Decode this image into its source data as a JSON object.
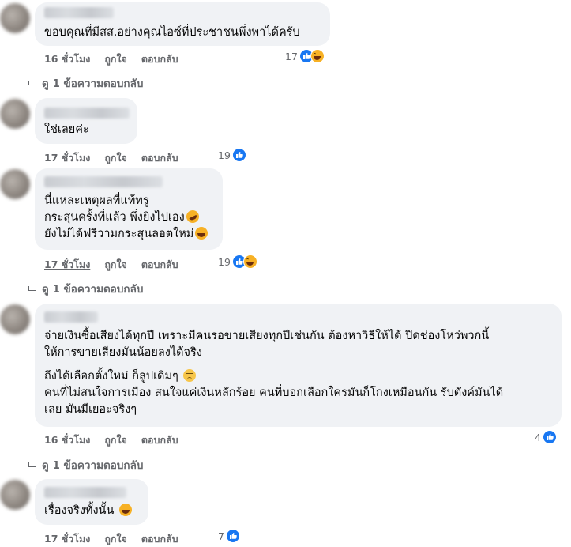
{
  "comments": [
    {
      "text": [
        "ขอบคุณที่มีสส.อย่างคุณไอซ์ที่ประชาชนพึ่งพาได้ครับ"
      ],
      "time": "16 ชั่วโมง",
      "like": "ถูกใจ",
      "reply": "ตอบกลับ",
      "reaction_count": "17",
      "reactions": [
        "like-icon",
        "haha-icon"
      ]
    },
    {
      "text": [
        "ใช่เลยค่ะ"
      ],
      "time": "17 ชั่วโมง",
      "like": "ถูกใจ",
      "reply": "ตอบกลับ",
      "reaction_count": "19",
      "reactions": [
        "like-icon"
      ]
    },
    {
      "text": [
        "นี่แหละเหตุผลที่แท้ทรู",
        "กระสุนครั้งที่แล้ว พึ่งยิงไปเอง",
        "ยังไม่ได้ฟรีวามกระสุนลอตใหม่"
      ],
      "time": "17 ชั่วโมง",
      "like": "ถูกใจ",
      "reply": "ตอบกลับ",
      "reaction_count": "19",
      "reactions": [
        "like-icon",
        "haha-icon"
      ]
    },
    {
      "text": [
        "จ่ายเงินซื้อเสียงได้ทุกปี เพราะมีคนรอขายเสียงทุกปีเช่นกัน ต้องหาวิธีให้ได้ ปิดช่องโหว่พวกนี้",
        "ให้การขายเสียงมันน้อยลงได้จริง",
        "ถึงได้เลือกตั้งใหม่ ก็ลูปเดิมๆ",
        "คนที่ไม่สนใจการเมือง สนใจแค่เงินหลักร้อย คนที่บอกเลือกใครมันก็โกงเหมือนกัน รับตังค์มันได้",
        "เลย มันมีเยอะจริงๆ"
      ],
      "time": "16 ชั่วโมง",
      "like": "ถูกใจ",
      "reply": "ตอบกลับ",
      "reaction_count": "4",
      "reactions": [
        "like-icon"
      ]
    },
    {
      "text": [
        "เรื่องจริงทั้งนั้น"
      ],
      "time": "17 ชั่วโมง",
      "like": "ถูกใจ",
      "reply": "ตอบกลับ",
      "reaction_count": "7",
      "reactions": [
        "like-icon"
      ]
    }
  ],
  "replies_link": "ดู 1 ข้อความตอบกลับ",
  "colors": {
    "bubble": "#f0f2f5",
    "meta": "#65676b",
    "like": "#1877f2",
    "haha": "#f7b125"
  }
}
